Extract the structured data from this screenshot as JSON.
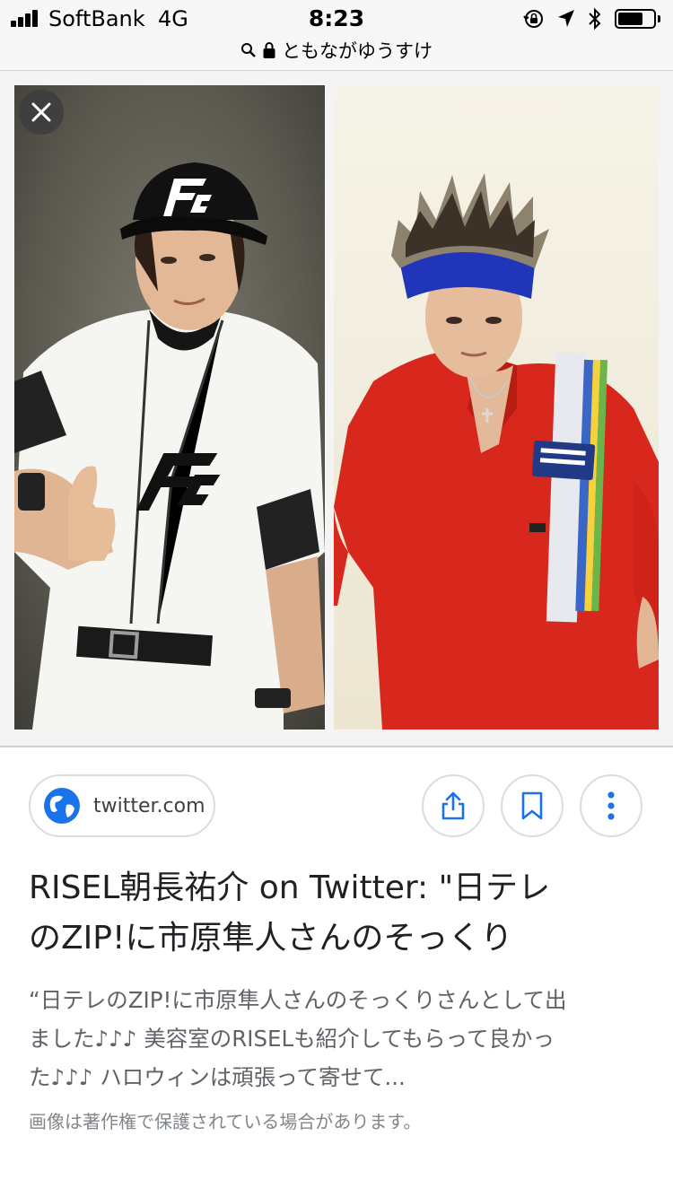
{
  "status_bar": {
    "carrier": "SoftBank",
    "network": "4G",
    "time": "8:23",
    "battery_level": 0.7,
    "icons": [
      "rotation-lock-icon",
      "location-icon",
      "bluetooth-icon",
      "battery-icon"
    ]
  },
  "browser": {
    "url_display": "ともながゆうすけ",
    "icons": [
      "search-icon",
      "lock-icon"
    ]
  },
  "image_viewer": {
    "photo_description_icon": "photo",
    "close_icon": "close-icon"
  },
  "result": {
    "source": "twitter.com",
    "title_line1": "RISEL朝長祐介 on Twitter: \"日テレ",
    "title_line2": "のZIP!に市原隼人さんのそっくり",
    "snippet_line1": "“日テレのZIP!に市原隼人さんのそっくりさんとして出",
    "snippet_line2": "ました♪♪♪ 美容室のRISELも紹介してもらって良かっ",
    "snippet_line3": "た♪♪♪ ハロウィンは頑張って寄せて...",
    "copyright": "画像は著作権で保護されている場合があります。"
  },
  "actions": [
    "share-icon",
    "bookmark-icon",
    "more-vert-icon"
  ],
  "colors": {
    "accent_blue": "#1a73e8",
    "title_text": "#202124",
    "snippet_text": "#5f6368"
  }
}
